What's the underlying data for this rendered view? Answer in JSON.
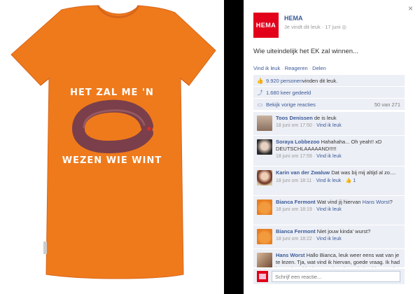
{
  "photo": {
    "shirt_text_top": "HET ZAL ME 'N",
    "shirt_text_bottom": "WEZEN WIE WINT",
    "colors": {
      "shirt": "#ef7a1c",
      "sausage": "#7a3f4a"
    }
  },
  "post": {
    "page_name": "HEMA",
    "logo_text": "HEMA",
    "liked_text": "Je vindt dit leuk",
    "date": "17 juni",
    "message": "Wie uiteindelijk het EK zal winnen...",
    "actions": [
      "Vind ik leuk",
      "Reageren",
      "Delen"
    ]
  },
  "ufi": {
    "likes_link": "9.920 personen",
    "likes_suffix": " vinden dit leuk.",
    "shares": "1.680 keer gedeeld",
    "prev_comments": "Bekijk vorige reacties",
    "prev_count": "50 van 271"
  },
  "comments": [
    {
      "name": "Toos Denissen",
      "text": "de is leuk",
      "time": "18 juni om 17:50",
      "like": "Vind ik leuk",
      "likes": ""
    },
    {
      "name": "Soraya Lobbezoo",
      "text": "Hahahaha... Oh yeah!! xD DEUTSCHLAAAAAND!!!!!",
      "time": "18 juni om 17:59",
      "like": "Vind ik leuk",
      "likes": ""
    },
    {
      "name": "Karin van der Zwaluw",
      "text": "Dat was bij mij altijd al zo....",
      "time": "18 juni om 18:11",
      "like": "Vind ik leuk",
      "likes": "1"
    },
    {
      "name": "Bianca Fermont",
      "text": "Wat vind jij hiervan ",
      "link": "Hans Worst",
      "text2": "?",
      "time": "18 juni om 18:19",
      "like": "Vind ik leuk",
      "likes": ""
    },
    {
      "name": "Bianca Fermont",
      "text": "Niet jouw kinda' wurst?",
      "time": "18 juni om 18:22",
      "like": "Vind ik leuk",
      "likes": ""
    },
    {
      "name": "Hans Worst",
      "text": "Hallo Bianca, leuk weer eens wat van je te lezen. Tja, wat vind ik hiervan, goede vraag. Ik had het toch wel leuk gevonden als Nederland iets verder was gekomen. Ans ook, zij",
      "time": "",
      "like": "",
      "likes": ""
    }
  ],
  "reply": {
    "placeholder": "Schrijf een reactie..."
  },
  "close_label": "×"
}
